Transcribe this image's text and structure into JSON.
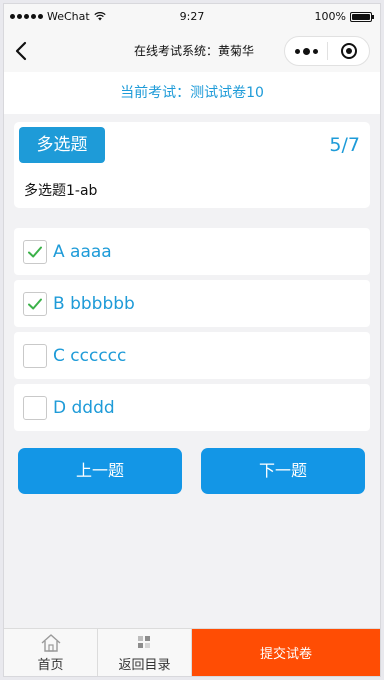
{
  "status_bar": {
    "carrier": "WeChat",
    "time": "9:27",
    "battery": "100%"
  },
  "nav": {
    "title": "在线考试系统：黄菊华"
  },
  "exam": {
    "current_label": "当前考试：测试试卷10"
  },
  "question": {
    "type": "多选题",
    "progress": "5/7",
    "text": "多选题1-ab"
  },
  "options": [
    {
      "label": "A aaaa",
      "checked": true
    },
    {
      "label": "B bbbbbb",
      "checked": true
    },
    {
      "label": "C cccccc",
      "checked": false
    },
    {
      "label": "D dddd",
      "checked": false
    }
  ],
  "buttons": {
    "prev": "上一题",
    "next": "下一题"
  },
  "tabbar": {
    "home": "首页",
    "catalog": "返回目录",
    "submit": "提交试卷"
  },
  "colors": {
    "accent": "#1e9bd8",
    "button": "#1396e6",
    "submit": "#ff4d04",
    "check": "#3cb24a"
  },
  "icons": [
    "wifi-icon",
    "back-icon",
    "more-icon",
    "close-icon",
    "check-icon",
    "home-icon",
    "grid-icon"
  ]
}
